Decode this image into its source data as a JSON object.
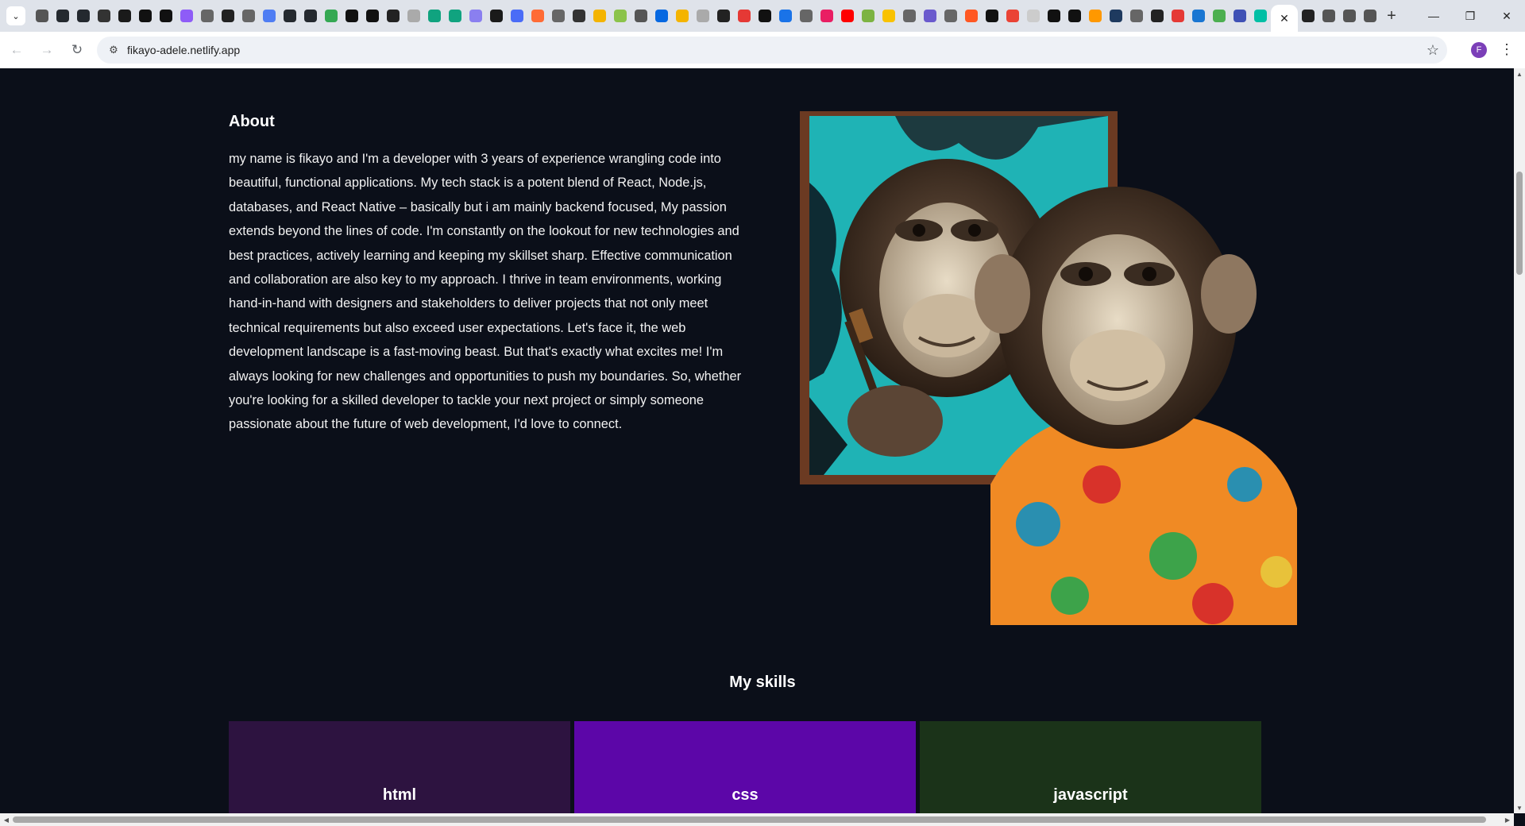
{
  "browser": {
    "url": "fikayo-adele.netlify.app",
    "profile_initial": "F",
    "tab_favicon_colors": [
      "#555555",
      "#24292f",
      "#24292f",
      "#333333",
      "#1a1a1a",
      "#111111",
      "#111111",
      "#8e5cf7",
      "#666666",
      "#222222",
      "#666666",
      "#4f7df3",
      "#24292f",
      "#24292f",
      "#34a853",
      "#111111",
      "#111111",
      "#222222",
      "#aaaaaa",
      "#10a37f",
      "#10a37f",
      "#8a7ff0",
      "#1a1a1a",
      "#4a6cf7",
      "#ff6b35",
      "#666666",
      "#333333",
      "#f4b400",
      "#8bc34a",
      "#555555",
      "#0668e1",
      "#f4b400",
      "#aaaaaa",
      "#222222",
      "#e53935",
      "#111111",
      "#1a73e8",
      "#666666",
      "#e91e63",
      "#ff0000",
      "#7cb342",
      "#f9c200",
      "#666666",
      "#6a5acd",
      "#666666",
      "#ff5722",
      "#111111",
      "#ea4335",
      "#cccccc",
      "#111111",
      "#111111",
      "#ff9800",
      "#1e3a5f",
      "#666666",
      "#222222",
      "#e53935",
      "#1976d2",
      "#4caf50",
      "#3f51b5",
      "#00bfa5",
      "#222222",
      "#555555",
      "#555555",
      "#555555"
    ]
  },
  "about": {
    "heading": "About",
    "body": "my name is fikayo and I'm a developer with 3 years of experience wrangling code into beautiful, functional applications. My tech stack is a potent blend of React, Node.js, databases, and React Native – basically but i am mainly backend focused, My passion extends beyond the lines of code. I'm constantly on the lookout for new technologies and best practices, actively learning and keeping my skillset sharp. Effective communication and collaboration are also key to my approach. I thrive in team environments, working hand-in-hand with designers and stakeholders to deliver projects that not only meet technical requirements but also exceed user expectations. Let's face it, the web development landscape is a fast-moving beast. But that's exactly what excites me! I'm always looking for new challenges and opportunities to push my boundaries. So, whether you're looking for a skilled developer to tackle your next project or simply someone passionate about the future of web development, I'd love to connect."
  },
  "skills": {
    "heading": "My skills",
    "items": [
      {
        "label": "html",
        "color": "#2d1340"
      },
      {
        "label": "css",
        "color": "#5c06a8"
      },
      {
        "label": "javascript",
        "color": "#1b3319"
      }
    ]
  }
}
